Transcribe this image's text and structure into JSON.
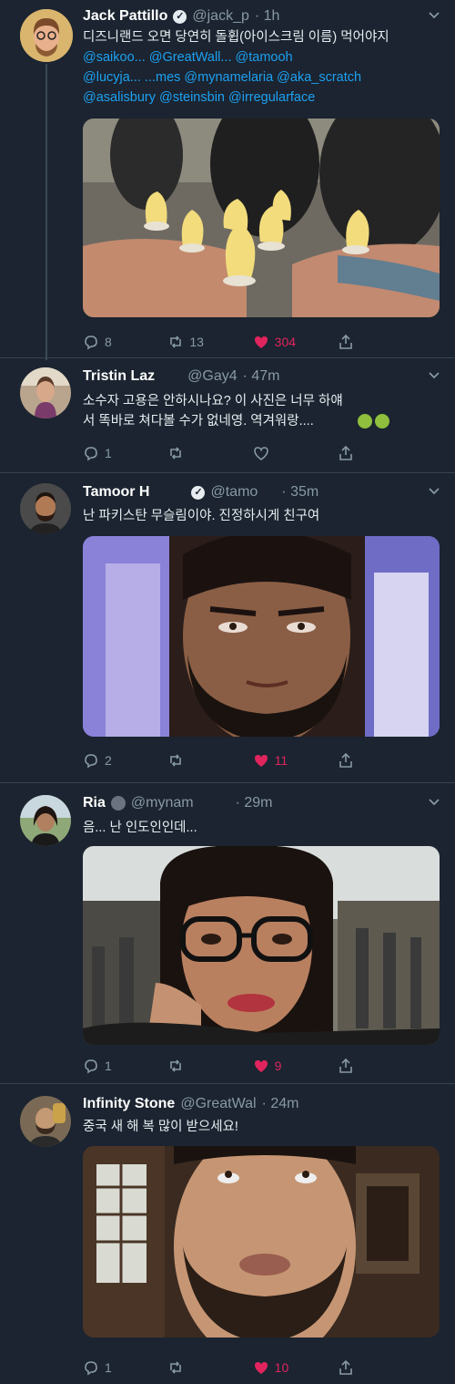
{
  "tweets": [
    {
      "name": "Jack Pattillo",
      "handle": "@jack_p",
      "time": "· 1h",
      "text": "디즈니랜드 오면 당연히 돌휩(아이스크림 이름) 먹어야지",
      "mentions_line1": "@saikoo... @GreatWall... @tamooh",
      "mentions_line2": "@lucyja... ...mes @mynamelaria @aka_scratch",
      "mentions_line3": "@asalisbury @steinsbin @irregularface",
      "replies": "8",
      "retweets": "13",
      "likes": "304",
      "avatar_color": "#c8a96a"
    },
    {
      "name": "Tristin Laz",
      "handle": "@Gay4",
      "time": "· 47m",
      "text_line1": "소수자 고용은 안하시나요? 이 사진은 너무 하얘",
      "text_line2": "서 똑바로 쳐다볼 수가 없네영. 역겨워랑....",
      "replies": "1",
      "retweets": "",
      "likes": ""
    },
    {
      "name": "Tamoor H",
      "handle": "@tamo",
      "time": "· 35m",
      "text": "난 파키스탄 무슬림이야. 진정하시게 친구여",
      "replies": "2",
      "retweets": "",
      "likes": "11"
    },
    {
      "name": "Ria",
      "handle": "@mynam",
      "time": "· 29m",
      "text": "음... 난 인도인인데...",
      "replies": "1",
      "retweets": "",
      "likes": "9"
    },
    {
      "name": "Infinity Stone",
      "handle": "@GreatWal",
      "time": "· 24m",
      "text": "중국 새 해 복 많이 받으세요!",
      "replies": "1",
      "retweets": "",
      "likes": "10"
    }
  ],
  "colors": {
    "background": "#1b2430",
    "mention": "#1da1f2",
    "like": "#e0245e",
    "muted": "#8899a6"
  },
  "icons": [
    "reply-icon",
    "retweet-icon",
    "like-icon",
    "share-icon",
    "chevron-down-icon",
    "verified-icon"
  ]
}
